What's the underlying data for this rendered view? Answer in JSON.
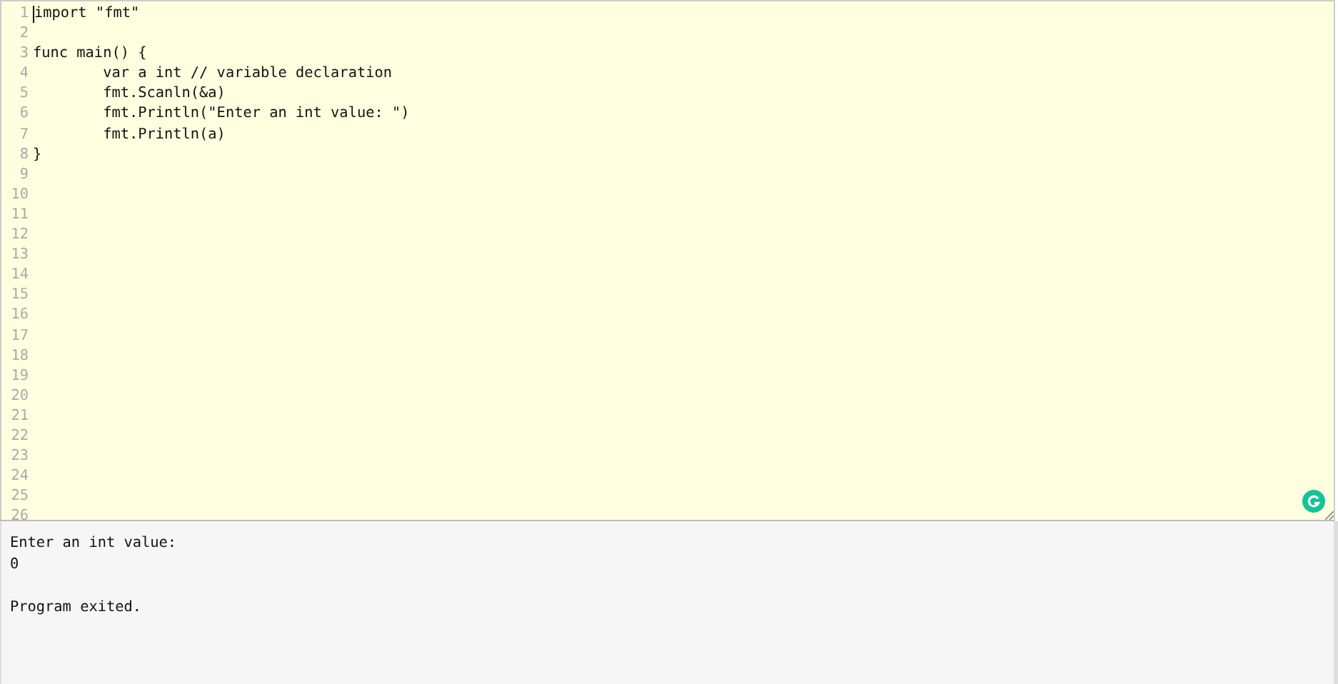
{
  "editor": {
    "lines": [
      {
        "number": "1",
        "code": "import \"fmt\"",
        "cursor": true
      },
      {
        "number": "2",
        "cursor": false
      },
      {
        "number": "3",
        "code": "func main() {",
        "cursor": false
      },
      {
        "number": "4",
        "code": "\tvar a int // variable declaration",
        "cursor": false
      },
      {
        "number": "5",
        "code": "\tfmt.Scanln(&a)",
        "cursor": false
      },
      {
        "number": "6",
        "code": "\tfmt.Println(\"Enter an int value: \")",
        "cursor": false
      },
      {
        "number": "7",
        "code": "\tfmt.Println(a)",
        "cursor": false
      },
      {
        "number": "8",
        "code": "}",
        "cursor": false
      },
      {
        "number": "9",
        "cursor": false
      },
      {
        "number": "10",
        "cursor": false
      },
      {
        "number": "11",
        "cursor": false
      },
      {
        "number": "12",
        "cursor": false
      },
      {
        "number": "13",
        "cursor": false
      },
      {
        "number": "14",
        "cursor": false
      },
      {
        "number": "15",
        "cursor": false
      },
      {
        "number": "16",
        "cursor": false
      },
      {
        "number": "17",
        "cursor": false
      },
      {
        "number": "18",
        "cursor": false
      },
      {
        "number": "19",
        "cursor": false
      },
      {
        "number": "20",
        "cursor": false
      },
      {
        "number": "21",
        "cursor": false
      },
      {
        "number": "22",
        "cursor": false
      },
      {
        "number": "23",
        "cursor": false
      },
      {
        "number": "24",
        "cursor": false
      },
      {
        "number": "25",
        "cursor": false
      },
      {
        "number": "26",
        "cursor": false
      }
    ]
  },
  "output": {
    "blocks": [
      {
        "lines": [
          "Enter an int value:",
          "0"
        ]
      },
      {
        "lines": [
          "Program exited."
        ]
      }
    ]
  }
}
